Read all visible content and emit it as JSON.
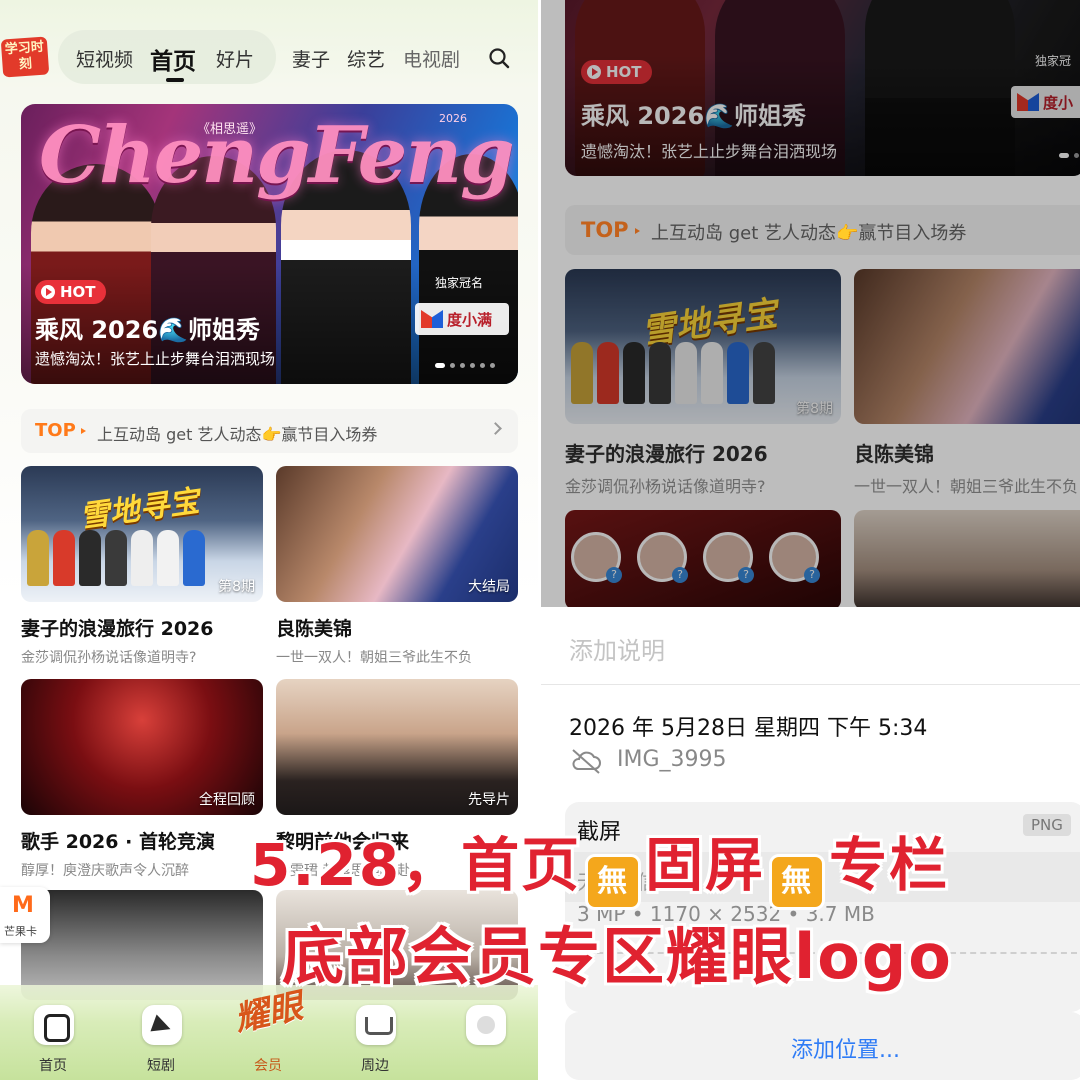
{
  "left": {
    "logo": "学习时刻",
    "nav": [
      "短视频",
      "首页",
      "好片",
      "妻子",
      "综艺",
      "电视剧"
    ],
    "hero": {
      "art_title": "ChengFeng",
      "art_sub": "《相思遥》",
      "art_year": "2026",
      "hot": "HOT",
      "title": "乘风 2026🌊师姐秀",
      "desc": "遗憾淘汰！张艺上止步舞台泪洒现场",
      "sponsor_caption": "独家冠名",
      "sponsor": "度小满"
    },
    "topbar": {
      "tag": "TOP",
      "text": "上互动岛 get 艺人动态👉赢节目入场券"
    },
    "cards": [
      {
        "art": "雪地寻宝",
        "label": "第8期",
        "title": "妻子的浪漫旅行 2026",
        "sub": "金莎调侃孙杨说话像道明寺?"
      },
      {
        "label": "大结局",
        "title": "良陈美锦",
        "sub": "一世一双人！朝姐三爷此生不负"
      },
      {
        "label": "全程回顾",
        "title": "歌手 2026 · 首轮竞演",
        "sub": "醇厚！庾澄庆歌声令人沉醉"
      },
      {
        "label": "先导片",
        "title": "黎明前他会归来",
        "sub": "毕雯珺 赵露思 向奔赴"
      }
    ],
    "mango": {
      "icon": "M",
      "label": "芒果卡"
    },
    "tabs": [
      "首页",
      "短剧",
      "会员",
      "周边"
    ],
    "vip_art": "耀眼"
  },
  "right": {
    "hero": {
      "hot": "HOT",
      "title": "乘风 2026🌊师姐秀",
      "desc": "遗憾淘汰！张艺上止步舞台泪洒现场",
      "sponsor_caption": "独家冠",
      "sponsor": "度小"
    },
    "topbar": {
      "tag": "TOP",
      "text": "上互动岛 get 艺人动态👉赢节目入场券"
    },
    "cards": [
      {
        "art": "雪地寻宝",
        "label": "第8期",
        "title": "妻子的浪漫旅行 2026",
        "sub": "金莎调侃孙杨说话像道明寺?"
      },
      {
        "label": "大",
        "title": "良陈美锦",
        "sub": "一世一双人！朝姐三爷此生不负"
      }
    ],
    "caption_placeholder": "添加说明",
    "datetime": "2026 年 5月28日 星期四 下午 5:34",
    "filename": "IMG_3995",
    "meta": {
      "title": "截屏",
      "format": "PNG",
      "sub": "无镜头信息",
      "specs": "3 MP • 1170 × 2532 • 3.7 MB"
    },
    "add_location": "添加位置..."
  },
  "overlay": {
    "line1_a": "5.28，首页",
    "line1_b": "固屏",
    "line1_c": "专栏",
    "emoji": "無",
    "line2": "底部会员专区耀眼logo"
  }
}
